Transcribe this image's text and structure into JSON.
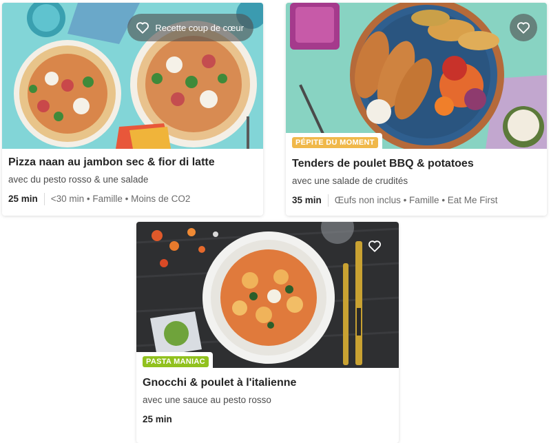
{
  "colors": {
    "badge_yellow": "#f0b84a",
    "badge_green": "#91c11e",
    "overlay": "#505050"
  },
  "cards": [
    {
      "favorite_label": "Recette coup de cœur",
      "favorite_icon": "heart-icon",
      "title": "Pizza naan au jambon sec & fior di latte",
      "subtitle": "avec du pesto rosso & une salade",
      "time": "25 min",
      "tags": "<30 min • Famille • Moins de CO2"
    },
    {
      "favorite_icon": "heart-icon",
      "badge": "PÉPITE DU MOMENT",
      "title": "Tenders de poulet BBQ & potatoes",
      "subtitle": "avec une salade de crudités",
      "time": "35 min",
      "tags": "Œufs non inclus • Famille • Eat Me First"
    },
    {
      "favorite_icon": "heart-icon",
      "badge": "PASTA MANIAC",
      "title": "Gnocchi & poulet à l'italienne",
      "subtitle": "avec une sauce au pesto rosso",
      "time": "25 min"
    }
  ]
}
